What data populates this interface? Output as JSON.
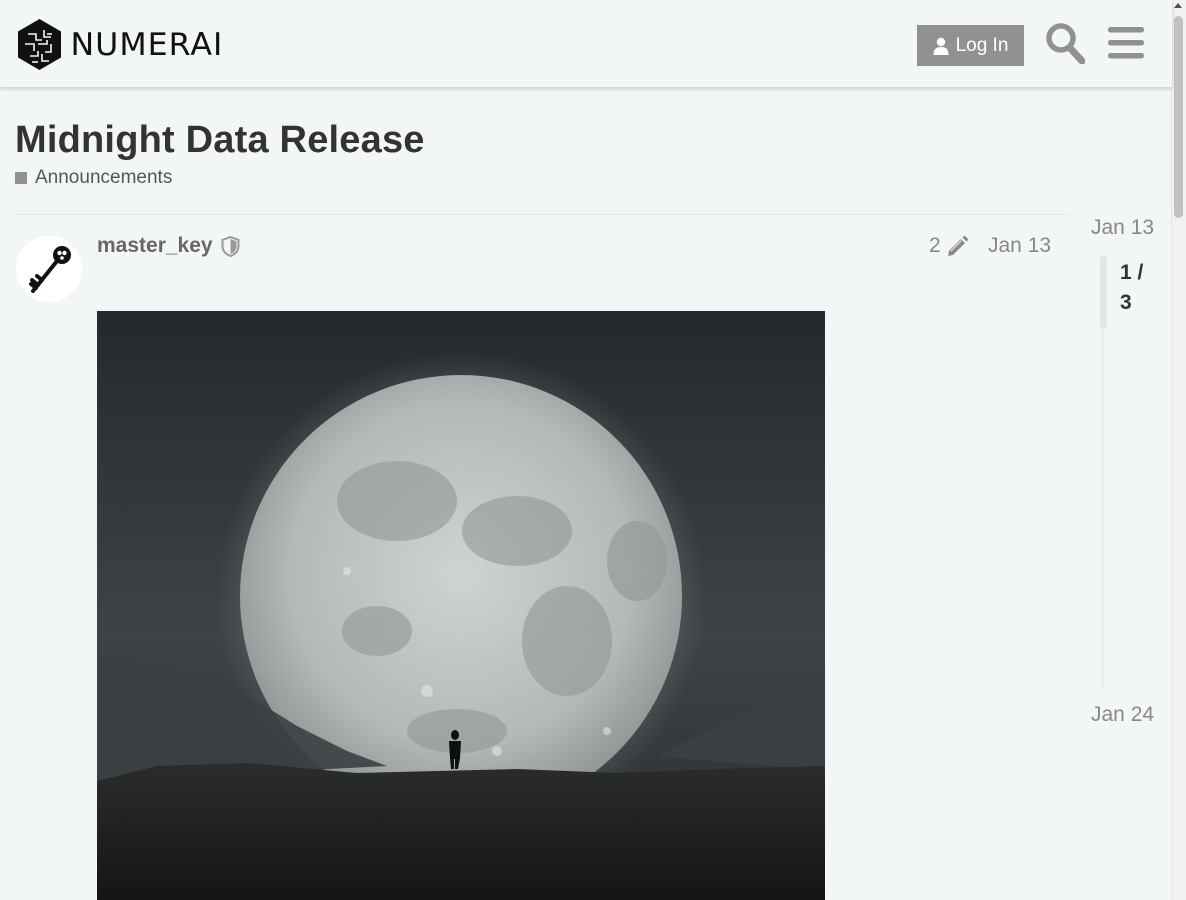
{
  "header": {
    "logo_text": "NUMERAI",
    "login_label": "Log In",
    "icons": {
      "user": "user-icon",
      "search": "search-icon",
      "menu": "hamburger-menu-icon"
    }
  },
  "topic": {
    "title": "Midnight Data Release",
    "category": {
      "label": "Announcements",
      "color": "#919191"
    }
  },
  "post": {
    "username": "master_key",
    "moderator_icon": "shield-icon",
    "edit_count": "2",
    "edit_icon": "pencil-icon",
    "date": "Jan 13",
    "avatar_icon": "key-icon",
    "image_subject": "moon-landscape"
  },
  "timeline": {
    "start_date": "Jan 13",
    "position_current": "1",
    "position_total": "3",
    "position_label": "1 / 3",
    "end_date": "Jan 24"
  },
  "colors": {
    "background": "#f3f6f7",
    "button": "#919191",
    "title": "#333333",
    "muted": "#888888"
  }
}
